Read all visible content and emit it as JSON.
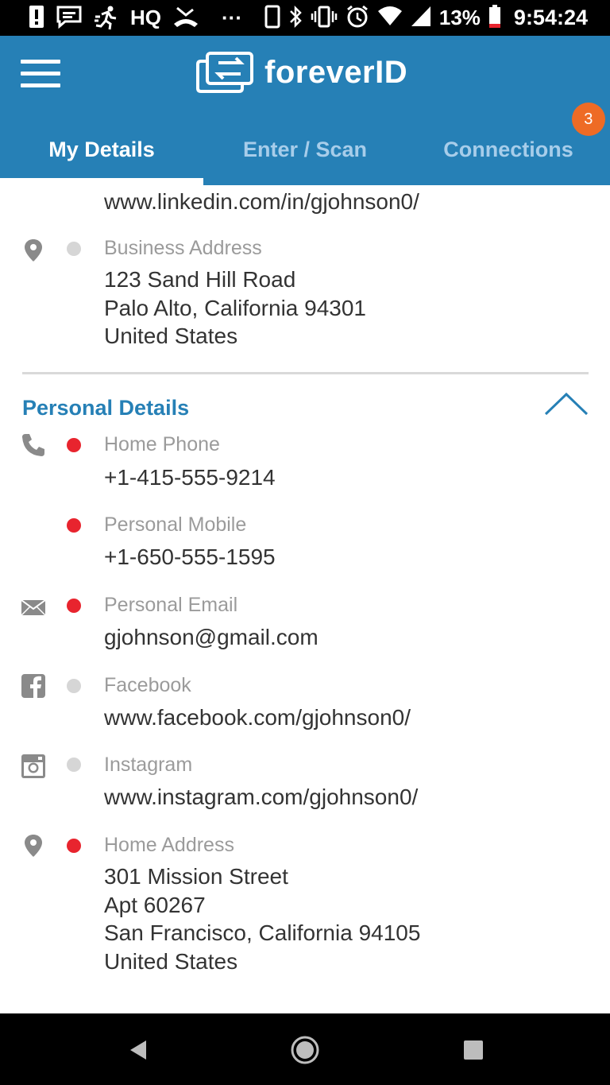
{
  "status_bar": {
    "battery_percent": "13%",
    "time": "9:54:24",
    "left_icons": [
      "alert-icon",
      "message-icon",
      "run-icon",
      "hq-icon",
      "missed-call-icon",
      "more-icon"
    ],
    "hq_label": "HQ",
    "more_label": "···"
  },
  "app": {
    "name": "foreverID"
  },
  "tabs": [
    {
      "label": "My Details",
      "active": true
    },
    {
      "label": "Enter / Scan",
      "active": false
    },
    {
      "label": "Connections",
      "active": false,
      "badge": "3"
    }
  ],
  "business": {
    "linkedin_value": "www.linkedin.com/in/gjohnson0/",
    "address_label": "Business Address",
    "address_value": "123 Sand Hill Road\nPalo Alto, California 94301\nUnited States"
  },
  "personal": {
    "title": "Personal Details",
    "items": [
      {
        "label": "Home Phone",
        "value": "+1-415-555-9214",
        "icon": "phone-icon",
        "dot": "red"
      },
      {
        "label": "Personal Mobile",
        "value": "+1-650-555-1595",
        "icon": "",
        "dot": "red"
      },
      {
        "label": "Personal Email",
        "value": "gjohnson@gmail.com",
        "icon": "email-icon",
        "dot": "red"
      },
      {
        "label": "Facebook",
        "value": "www.facebook.com/gjohnson0/",
        "icon": "facebook-icon",
        "dot": "gray"
      },
      {
        "label": "Instagram",
        "value": "www.instagram.com/gjohnson0/",
        "icon": "instagram-icon",
        "dot": "gray"
      },
      {
        "label": "Home Address",
        "value": "301 Mission Street\nApt 60267\nSan Francisco, California 94105\nUnited States",
        "icon": "location-icon",
        "dot": "red"
      }
    ]
  },
  "colors": {
    "brand": "#2680b6",
    "badge": "#ee6b25",
    "dot_red": "#e8242e",
    "dot_gray": "#d6d6d6"
  }
}
